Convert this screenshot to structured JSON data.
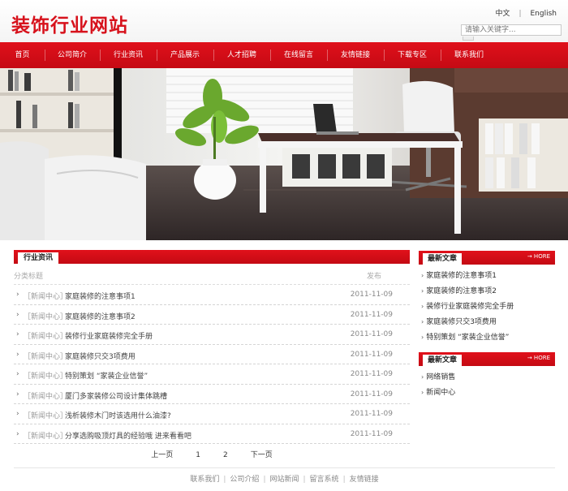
{
  "header": {
    "logo": "装饰行业网站",
    "lang_cn": "中文",
    "lang_sep": "|",
    "lang_en": "English",
    "search_placeholder": "请输入关键字..."
  },
  "nav": [
    "首页",
    "公司简介",
    "行业资讯",
    "产品展示",
    "人才招聘",
    "在线留言",
    "友情链接",
    "下载专区",
    "联系我们"
  ],
  "main": {
    "section_title": "行业资讯",
    "col_category": "分类标题",
    "col_date": "发布",
    "arrow": "›",
    "rows": [
      {
        "category": "［新闻中心］",
        "title": "家庭装修的注意事项1",
        "date": "2011-11-09"
      },
      {
        "category": "［新闻中心］",
        "title": "家庭装修的注意事项2",
        "date": "2011-11-09"
      },
      {
        "category": "［新闻中心］",
        "title": "装修行业家庭装修完全手册",
        "date": "2011-11-09"
      },
      {
        "category": "［新闻中心］",
        "title": "家庭装修只交3项费用",
        "date": "2011-11-09"
      },
      {
        "category": "［新闻中心］",
        "title": "特别策划 “家装企业信誉”",
        "date": "2011-11-09"
      },
      {
        "category": "［新闻中心］",
        "title": "厦门多家装修公司设计集体跳槽",
        "date": "2011-11-09"
      },
      {
        "category": "［新闻中心］",
        "title": "浅析装修木门时该选用什么油漆?",
        "date": "2011-11-09"
      },
      {
        "category": "［新闻中心］",
        "title": "分享选购吸顶灯具的经验哦 进来看看吧",
        "date": "2011-11-09"
      }
    ],
    "pager": {
      "prev": "上一页",
      "p1": "1",
      "p2": "2",
      "next": "下一页"
    }
  },
  "sidebar": {
    "more": "→ HORE",
    "box1": {
      "title": "最新文章",
      "items": [
        "家庭装修的注意事项1",
        "家庭装修的注意事项2",
        "装修行业家庭装修完全手册",
        "家庭装修只交3项费用",
        "特别策划 “家装企业信誉”"
      ]
    },
    "box2": {
      "title": "最新文章",
      "items": [
        "网络销售",
        "新闻中心"
      ]
    }
  },
  "footer": {
    "links": [
      "联系我们",
      "公司介绍",
      "网站新闻",
      "留言系统",
      "友情链接"
    ],
    "sep": "|"
  },
  "colors": {
    "brand": "#d7121c",
    "nav": "#d10e18"
  }
}
